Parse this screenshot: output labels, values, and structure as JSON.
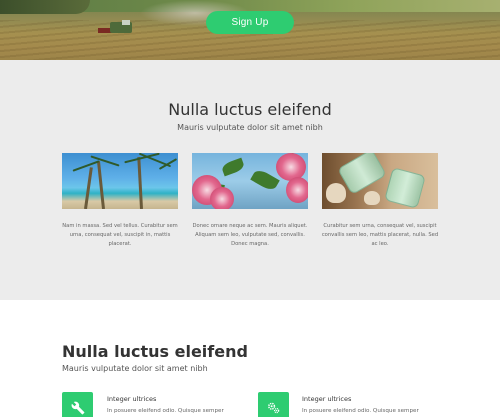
{
  "hero": {
    "signup_label": "Sign Up"
  },
  "section1": {
    "title": "Nulla luctus eleifend",
    "subtitle": "Mauris vulputate dolor sit amet nibh",
    "cards": [
      {
        "image": "beach-palm-trees",
        "text": "Nam in massa. Sed vel tellus. Curabitur sem urna, consequat vel, suscipit in, mattis placerat."
      },
      {
        "image": "pink-flowers",
        "text": "Donec ornare neque ac sem. Mauris aliquet. Aliquam sem leo, vulputate sed, convallis. Donec magna."
      },
      {
        "image": "glass-jars-shells",
        "text": "Curabitur sem urna, consequat vel, suscipit convallis sem leo, mattis placerat, nulla. Sed ac leo."
      }
    ]
  },
  "section2": {
    "title": "Nulla luctus eleifend",
    "subtitle": "Mauris vulputate dolor sit amet nibh",
    "features": [
      {
        "icon": "wrench-icon",
        "title": "Integer ultrices",
        "desc": "In posuere eleifend odio. Quisque semper"
      },
      {
        "icon": "gears-icon",
        "title": "Integer ultrices",
        "desc": "In posuere eleifend odio. Quisque semper"
      }
    ]
  },
  "colors": {
    "accent": "#2ecc71",
    "gray_bg": "#ececec"
  }
}
